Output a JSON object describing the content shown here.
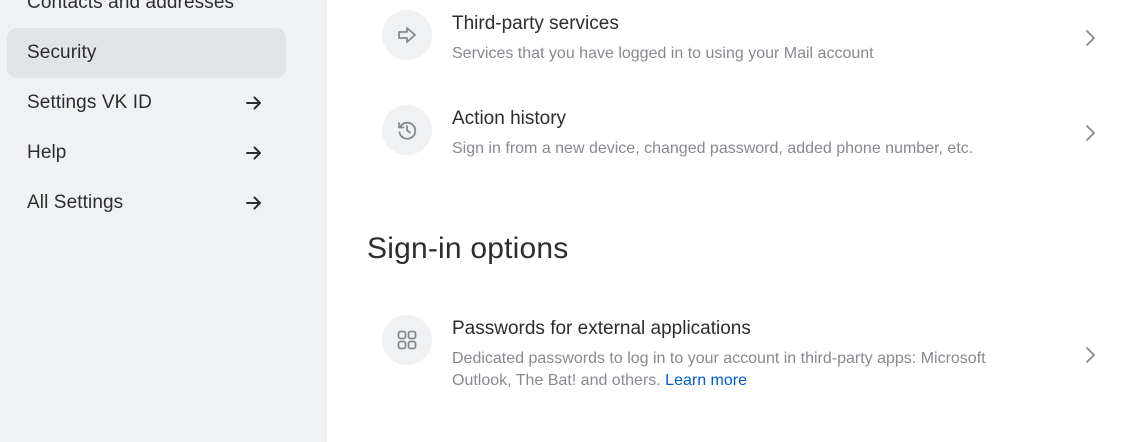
{
  "sidebar": {
    "items": [
      {
        "label": "Contacts and addresses",
        "active": false,
        "external": false
      },
      {
        "label": "Security",
        "active": true,
        "external": false
      },
      {
        "label": "Settings VK ID",
        "active": false,
        "external": true
      },
      {
        "label": "Help",
        "active": false,
        "external": true
      },
      {
        "label": "All Settings",
        "active": false,
        "external": true
      }
    ]
  },
  "main": {
    "rows": [
      {
        "title": "Third-party services",
        "description": "Services that you have logged in to using your Mail account",
        "icon": "arrow-right-icon"
      },
      {
        "title": "Action history",
        "description": "Sign in from a new device, changed password, added phone number, etc.",
        "icon": "history-icon"
      }
    ],
    "section_title": "Sign-in options",
    "app_passwords": {
      "title": "Passwords for external applications",
      "description": "Dedicated passwords to log in to your account in third-party apps: Microsoft Outlook, The Bat! and others.",
      "learn_more": "Learn more",
      "icon": "apps-grid-icon"
    }
  },
  "colors": {
    "sidebar_bg": "#f0f1f3",
    "active_item_bg": "#e2e3e7",
    "text_primary": "#2c2d2e",
    "text_secondary": "#87898f",
    "link": "#005bd1"
  }
}
